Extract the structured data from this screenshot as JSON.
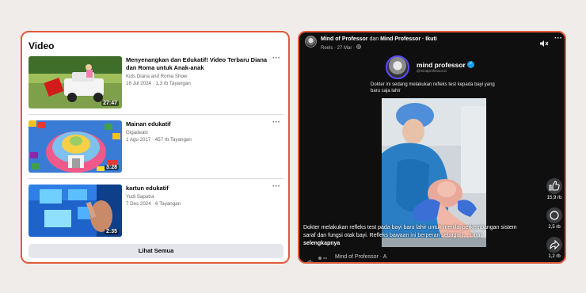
{
  "left": {
    "title": "Video",
    "more_icon": "more-icon",
    "see_all_label": "Lihat Semua",
    "videos": [
      {
        "title": "Menyenangkan dan Edukatif! Video Terbaru Diana dan Roma untuk Anak-anak",
        "channel": "Kids Diana and Roma Show",
        "stats": "16 Jul 2024 · 1,3 rb Tayangan",
        "duration": "27:47"
      },
      {
        "title": "Mainan edukatif",
        "channel": "Gigadeals",
        "stats": "1 Agu 2017 · 457 rb Tayangan",
        "duration": "3:28"
      },
      {
        "title": "kartun edukatif",
        "channel": "Yudi Saputra",
        "stats": "7 Des 2024 · 6 Tayangan",
        "duration": "2:35"
      }
    ]
  },
  "right": {
    "page_name": "Mind of Professor",
    "connector": " dan ",
    "second_page": "Mind Professor",
    "follow_label": " · Ikuti",
    "sub": "Reels · 27 Mar ·",
    "inner_name": "mind professor",
    "inner_handle": "@mindprofessor.id",
    "inner_caption": "Dokter ini sedang melakukan refleks test kepada bayi yang baru saja lahir",
    "caption": "Dokter melakukan refleks test pada bayi baru lahir untuk menilai perkembangan sistem saraf dan fungsi otak bayi. Refleks bawaan ini berperan sebagai i... Lihat",
    "see_more": "selengkapnya",
    "likes": "15,9 rb",
    "comments": "2,5 rb",
    "shares": "1,2 rb",
    "music": "Mind of Professor · A"
  }
}
